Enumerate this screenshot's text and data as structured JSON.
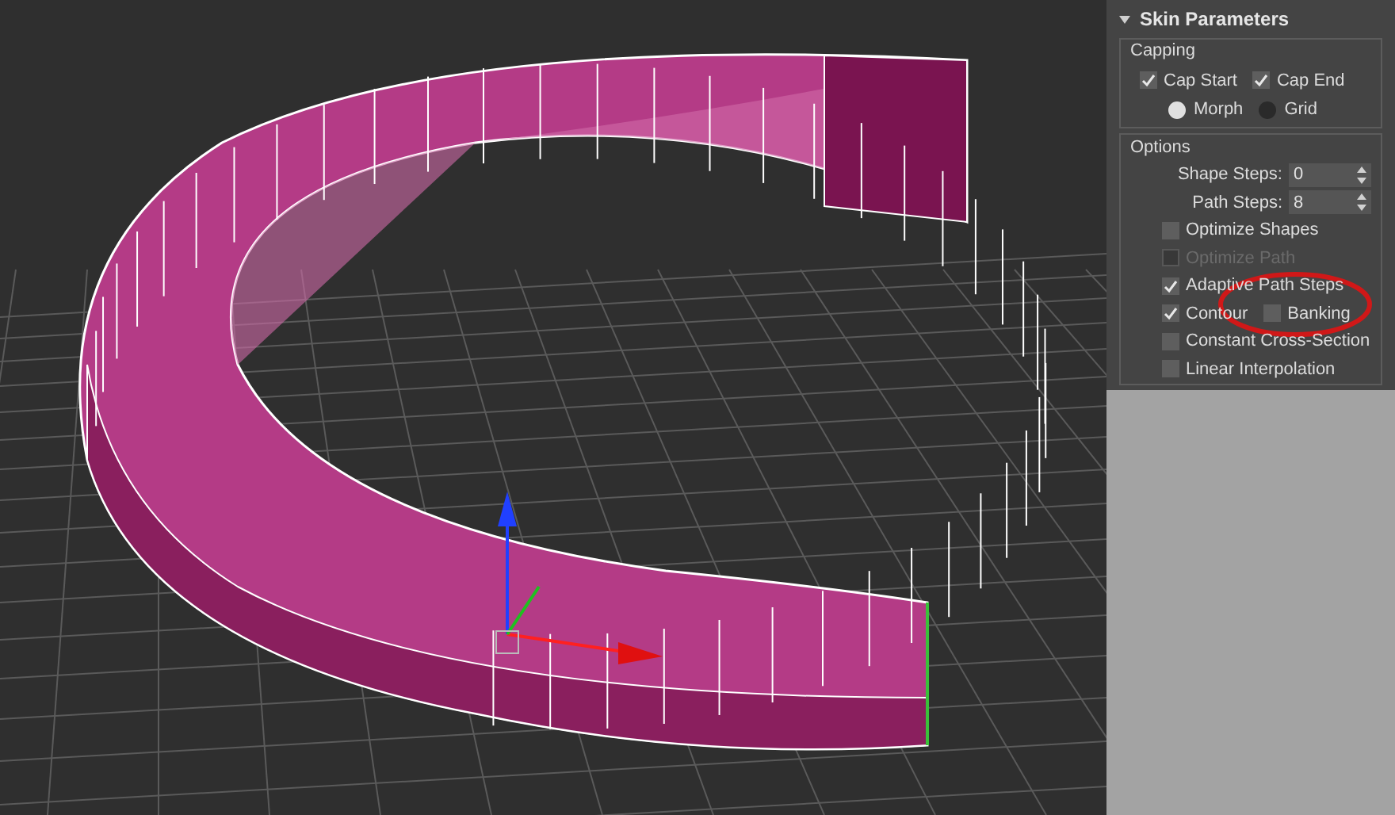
{
  "rollout": {
    "title": "Skin Parameters",
    "expanded": true,
    "capping": {
      "title": "Capping",
      "checkboxes": [
        {
          "label": "Cap Start",
          "checked": true
        },
        {
          "label": "Cap End",
          "checked": true
        }
      ],
      "radios": [
        {
          "label": "Morph",
          "selected": true
        },
        {
          "label": "Grid",
          "selected": false
        }
      ]
    },
    "options": {
      "title": "Options",
      "spinners": [
        {
          "label": "Shape Steps:",
          "value": "0"
        },
        {
          "label": "Path Steps:",
          "value": "8"
        }
      ],
      "rows": [
        [
          {
            "label": "Optimize Shapes",
            "checked": false,
            "disabled": false
          }
        ],
        [
          {
            "label": "Optimize Path",
            "checked": false,
            "disabled": true
          }
        ],
        [
          {
            "label": "Adaptive Path Steps",
            "checked": true,
            "disabled": false
          }
        ],
        [
          {
            "label": "Contour",
            "checked": true,
            "disabled": false
          },
          {
            "label": "Banking",
            "checked": false,
            "disabled": false
          }
        ],
        [
          {
            "label": "Constant Cross-Section",
            "checked": false,
            "disabled": false
          }
        ],
        [
          {
            "label": "Linear Interpolation",
            "checked": false,
            "disabled": false
          }
        ]
      ]
    }
  }
}
